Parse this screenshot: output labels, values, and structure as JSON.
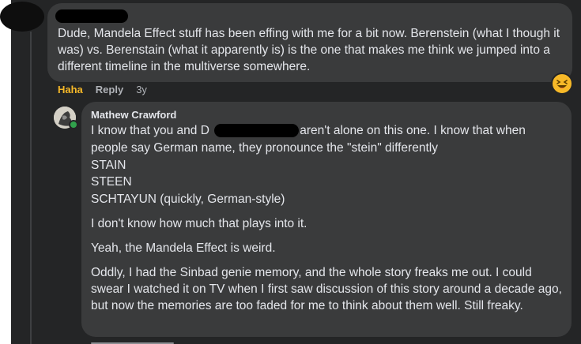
{
  "comment1": {
    "text": "Dude, Mandela Effect stuff has been effing with me for a bit now. Berenstein (what I though it was) vs. Berenstain (what it apparently is) is the one that makes me think we jumped into a different timeline in the multiverse somewhere.",
    "actions": {
      "haha": "Haha",
      "reply": "Reply",
      "time": "3y"
    },
    "reaction": "laughing-emoji"
  },
  "comment2": {
    "author": "Mathew Crawford",
    "line1_before": "I know that you and D",
    "line1_after": " aren't alone on this one. I know that when",
    "line2": "people say German name, they pronounce the \"stein\" differently",
    "line3": "STAIN",
    "line4": "STEEN",
    "line5": "SCHTAYUN (quickly, German-style)",
    "p2": "I don't know how much that plays into it.",
    "p3": "Yeah, the Mandela Effect is weird.",
    "p4": "Oddly, I had the Sinbad genie memory, and the whole story freaks me out. I could swear I watched it on TV when I first saw discussion of this story around a decade ago, but now the memories are too faded for me to think about them well. Still freaky."
  },
  "colors": {
    "background": "#242526",
    "bubble": "#3a3b3c",
    "text": "#e4e6eb",
    "haha": "#f7b928",
    "muted": "#b0b3b8",
    "online": "#31a24c"
  }
}
